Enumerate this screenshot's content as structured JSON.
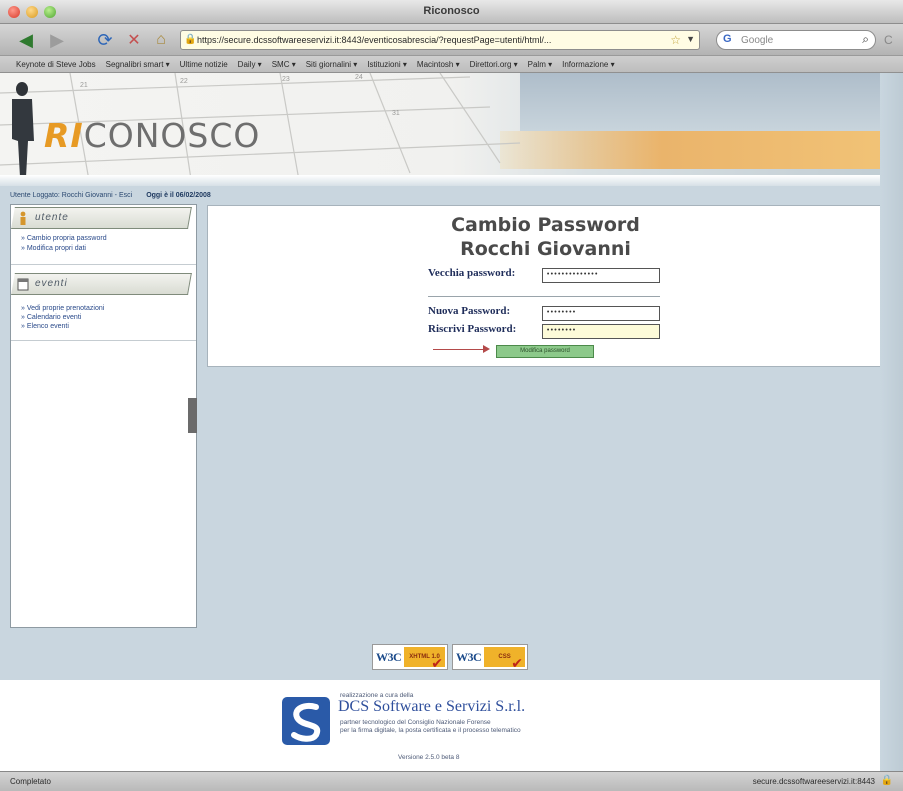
{
  "window": {
    "title": "Riconosco"
  },
  "toolbar": {
    "url": "https://secure.dcssoftwareeservizi.it:8443/eventicosabrescia/?requestPage=utenti/html/...",
    "search_placeholder": "Google"
  },
  "bookmarks": [
    "Keynote di Steve Jobs",
    "Segnalibri smart ▾",
    "Ultime notizie",
    "Daily ▾",
    "SMC ▾",
    "Siti giornalini ▾",
    "Istituzioni ▾",
    "Macintosh ▾",
    "Direttori.org ▾",
    "Palm ▾",
    "Informazione ▾"
  ],
  "banner": {
    "logo_ri": "RI",
    "logo_rest": "CONOSCO"
  },
  "userbar": {
    "user": "Utente Loggato: Rocchi Giovanni - Esci",
    "today": "Oggi è il 06/02/2008"
  },
  "sidebar": {
    "sections": [
      {
        "title": "utente",
        "icon": "user-icon",
        "links": [
          "Cambio propria password",
          "Modifica propri dati"
        ]
      },
      {
        "title": "eventi",
        "icon": "calendar-icon",
        "links": [
          "Vedi proprie prenotazioni",
          "Calendario eventi",
          "Elenco eventi"
        ]
      }
    ]
  },
  "form": {
    "title": "Cambio Password",
    "subtitle": "Rocchi Giovanni",
    "old_label": "Vecchia password:",
    "old_value": "••••••••••••••",
    "new_label": "Nuova Password:",
    "new_value": "••••••••",
    "repeat_label": "Riscrivi Password:",
    "repeat_value": "••••••••",
    "submit_label": "Modifica password"
  },
  "badges": [
    {
      "w3c": "W3C",
      "tag": "XHTML 1.0"
    },
    {
      "w3c": "W3C",
      "tag": "CSS"
    }
  ],
  "footer": {
    "made_by": "realizzazione a cura della",
    "company": "DCS Software e Servizi S.r.l.",
    "line1": "partner tecnologico del Consiglio Nazionale Forense",
    "line2": "per la firma digitale, la posta certificata e il processo telematico",
    "version": "Versione 2.5.0 beta 8"
  },
  "status": {
    "left": "Completato",
    "right": "secure.dcssoftwareeservizi.it:8443"
  },
  "colors": {
    "page_bg": "#c9d6df",
    "logo_accent": "#e79a24",
    "link": "#2a4a8a",
    "submit": "#8cc98a"
  }
}
